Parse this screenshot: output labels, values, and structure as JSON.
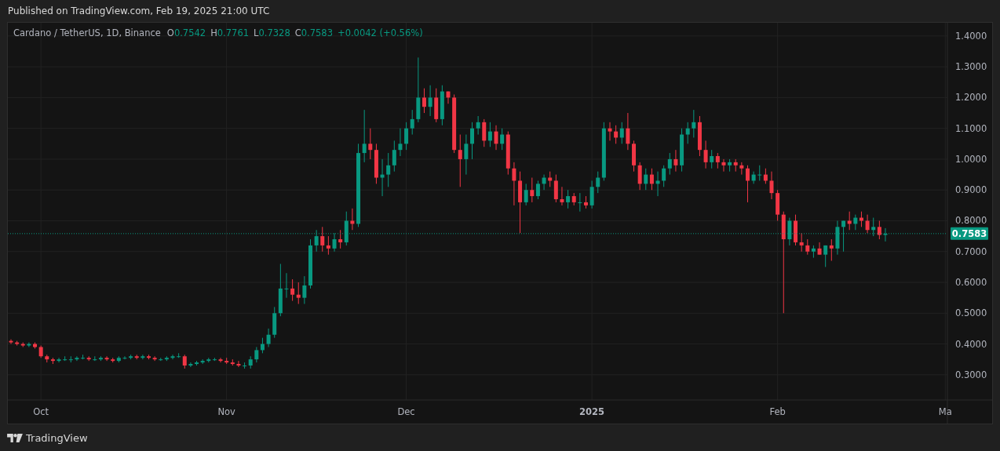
{
  "header": {
    "published": "Published on TradingView.com, Feb 19, 2025 21:00 UTC"
  },
  "legend": {
    "symbol": "Cardano / TetherUS, 1D, Binance",
    "values": [
      {
        "label": "O",
        "value": "0.7542"
      },
      {
        "label": "H",
        "value": "0.7761"
      },
      {
        "label": "L",
        "value": "0.7328"
      },
      {
        "label": "C",
        "value": "0.7583"
      }
    ],
    "change": "+0.0042 (+0.56%)"
  },
  "chart_data": {
    "type": "candlestick",
    "grid": true,
    "ylim": [
      0.218,
      1.443
    ],
    "yticks": [
      {
        "value": 1.4,
        "label": "1.4000"
      },
      {
        "value": 1.3,
        "label": "1.3000"
      },
      {
        "value": 1.2,
        "label": "1.2000"
      },
      {
        "value": 1.1,
        "label": "1.1000"
      },
      {
        "value": 1.0,
        "label": "1.0000"
      },
      {
        "value": 0.9,
        "label": "0.9000"
      },
      {
        "value": 0.8,
        "label": "0.8000"
      },
      {
        "value": 0.7,
        "label": "0.7000"
      },
      {
        "value": 0.6,
        "label": "0.6000"
      },
      {
        "value": 0.5,
        "label": "0.5000"
      },
      {
        "value": 0.4,
        "label": "0.4000"
      },
      {
        "value": 0.3,
        "label": "0.3000"
      }
    ],
    "categories": [
      null,
      null,
      null,
      null,
      null,
      "Oct",
      null,
      null,
      null,
      null,
      null,
      null,
      null,
      null,
      null,
      null,
      null,
      null,
      null,
      null,
      null,
      null,
      null,
      null,
      null,
      null,
      null,
      null,
      null,
      null,
      null,
      null,
      null,
      null,
      null,
      null,
      "Nov",
      null,
      null,
      null,
      null,
      null,
      null,
      null,
      null,
      null,
      null,
      null,
      null,
      null,
      null,
      null,
      null,
      null,
      null,
      null,
      null,
      null,
      null,
      null,
      null,
      null,
      null,
      null,
      null,
      null,
      "Dec",
      null,
      null,
      null,
      null,
      null,
      null,
      null,
      null,
      null,
      null,
      null,
      null,
      null,
      null,
      null,
      null,
      null,
      null,
      null,
      null,
      null,
      null,
      null,
      null,
      null,
      null,
      null,
      null,
      null,
      null,
      "2025",
      null,
      null,
      null,
      null,
      null,
      null,
      null,
      null,
      null,
      null,
      null,
      null,
      null,
      null,
      null,
      null,
      null,
      null,
      null,
      null,
      null,
      null,
      null,
      null,
      null,
      null,
      null,
      null,
      null,
      null,
      "Feb",
      null,
      null,
      null,
      null,
      null,
      null,
      null,
      null,
      null,
      null,
      null,
      null,
      null,
      null,
      null,
      null,
      null,
      null,
      null,
      null,
      null,
      null,
      null,
      null,
      null,
      null,
      null,
      "Ma"
    ],
    "ref_lines": [
      {
        "axis": "y",
        "value": 0.7583,
        "label": "0.7583",
        "color": "#089981"
      }
    ],
    "ohlc": [
      [
        0.41,
        0.415,
        0.4,
        0.405
      ],
      [
        0.405,
        0.41,
        0.395,
        0.4
      ],
      [
        0.4,
        0.405,
        0.39,
        0.395
      ],
      [
        0.395,
        0.405,
        0.39,
        0.4
      ],
      [
        0.4,
        0.405,
        0.385,
        0.39
      ],
      [
        0.39,
        0.395,
        0.355,
        0.36
      ],
      [
        0.36,
        0.365,
        0.34,
        0.35
      ],
      [
        0.35,
        0.355,
        0.335,
        0.345
      ],
      [
        0.345,
        0.355,
        0.34,
        0.35
      ],
      [
        0.35,
        0.36,
        0.345,
        0.35
      ],
      [
        0.35,
        0.36,
        0.34,
        0.35
      ],
      [
        0.35,
        0.36,
        0.345,
        0.355
      ],
      [
        0.355,
        0.365,
        0.35,
        0.355
      ],
      [
        0.355,
        0.36,
        0.345,
        0.35
      ],
      [
        0.35,
        0.36,
        0.345,
        0.35
      ],
      [
        0.35,
        0.36,
        0.345,
        0.355
      ],
      [
        0.355,
        0.36,
        0.345,
        0.35
      ],
      [
        0.35,
        0.355,
        0.34,
        0.345
      ],
      [
        0.345,
        0.36,
        0.34,
        0.355
      ],
      [
        0.355,
        0.36,
        0.35,
        0.355
      ],
      [
        0.355,
        0.365,
        0.35,
        0.36
      ],
      [
        0.36,
        0.365,
        0.35,
        0.355
      ],
      [
        0.355,
        0.365,
        0.35,
        0.36
      ],
      [
        0.36,
        0.365,
        0.35,
        0.355
      ],
      [
        0.355,
        0.36,
        0.345,
        0.35
      ],
      [
        0.35,
        0.355,
        0.345,
        0.35
      ],
      [
        0.35,
        0.36,
        0.345,
        0.355
      ],
      [
        0.355,
        0.365,
        0.35,
        0.36
      ],
      [
        0.36,
        0.37,
        0.355,
        0.36
      ],
      [
        0.36,
        0.365,
        0.32,
        0.33
      ],
      [
        0.33,
        0.34,
        0.325,
        0.335
      ],
      [
        0.335,
        0.345,
        0.33,
        0.34
      ],
      [
        0.34,
        0.35,
        0.335,
        0.345
      ],
      [
        0.345,
        0.355,
        0.34,
        0.35
      ],
      [
        0.35,
        0.355,
        0.345,
        0.35
      ],
      [
        0.35,
        0.355,
        0.34,
        0.345
      ],
      [
        0.345,
        0.355,
        0.335,
        0.34
      ],
      [
        0.34,
        0.35,
        0.33,
        0.335
      ],
      [
        0.335,
        0.345,
        0.325,
        0.33
      ],
      [
        0.33,
        0.34,
        0.32,
        0.33
      ],
      [
        0.33,
        0.36,
        0.32,
        0.35
      ],
      [
        0.35,
        0.39,
        0.34,
        0.38
      ],
      [
        0.38,
        0.42,
        0.37,
        0.4
      ],
      [
        0.4,
        0.45,
        0.39,
        0.43
      ],
      [
        0.43,
        0.52,
        0.42,
        0.5
      ],
      [
        0.5,
        0.66,
        0.49,
        0.58
      ],
      [
        0.58,
        0.63,
        0.55,
        0.58
      ],
      [
        0.58,
        0.61,
        0.54,
        0.56
      ],
      [
        0.56,
        0.6,
        0.53,
        0.55
      ],
      [
        0.55,
        0.62,
        0.53,
        0.59
      ],
      [
        0.59,
        0.74,
        0.58,
        0.72
      ],
      [
        0.72,
        0.77,
        0.7,
        0.75
      ],
      [
        0.75,
        0.78,
        0.7,
        0.72
      ],
      [
        0.72,
        0.75,
        0.69,
        0.71
      ],
      [
        0.71,
        0.76,
        0.7,
        0.74
      ],
      [
        0.74,
        0.77,
        0.71,
        0.73
      ],
      [
        0.73,
        0.83,
        0.72,
        0.8
      ],
      [
        0.8,
        0.84,
        0.77,
        0.79
      ],
      [
        0.79,
        1.05,
        0.78,
        1.02
      ],
      [
        1.02,
        1.16,
        0.99,
        1.05
      ],
      [
        1.05,
        1.1,
        1.0,
        1.03
      ],
      [
        1.03,
        1.05,
        0.92,
        0.94
      ],
      [
        0.94,
        1.0,
        0.88,
        0.95
      ],
      [
        0.95,
        1.02,
        0.91,
        0.98
      ],
      [
        0.98,
        1.06,
        0.96,
        1.03
      ],
      [
        1.03,
        1.1,
        1.01,
        1.05
      ],
      [
        1.05,
        1.12,
        1.03,
        1.1
      ],
      [
        1.1,
        1.16,
        1.08,
        1.13
      ],
      [
        1.13,
        1.33,
        1.12,
        1.2
      ],
      [
        1.2,
        1.23,
        1.15,
        1.17
      ],
      [
        1.17,
        1.24,
        1.14,
        1.2
      ],
      [
        1.2,
        1.23,
        1.12,
        1.13
      ],
      [
        1.13,
        1.24,
        1.11,
        1.22
      ],
      [
        1.22,
        1.22,
        1.18,
        1.2
      ],
      [
        1.2,
        1.21,
        1.02,
        1.03
      ],
      [
        1.03,
        1.08,
        0.91,
        1.0
      ],
      [
        1.0,
        1.08,
        0.95,
        1.05
      ],
      [
        1.05,
        1.12,
        1.0,
        1.1
      ],
      [
        1.1,
        1.14,
        1.08,
        1.12
      ],
      [
        1.12,
        1.13,
        1.04,
        1.06
      ],
      [
        1.06,
        1.12,
        1.04,
        1.09
      ],
      [
        1.09,
        1.11,
        1.03,
        1.05
      ],
      [
        1.05,
        1.1,
        1.03,
        1.08
      ],
      [
        1.08,
        1.09,
        0.95,
        0.97
      ],
      [
        0.97,
        0.99,
        0.85,
        0.93
      ],
      [
        0.93,
        0.96,
        0.76,
        0.86
      ],
      [
        0.86,
        0.92,
        0.85,
        0.9
      ],
      [
        0.9,
        0.94,
        0.86,
        0.88
      ],
      [
        0.88,
        0.93,
        0.87,
        0.92
      ],
      [
        0.92,
        0.95,
        0.9,
        0.94
      ],
      [
        0.94,
        0.96,
        0.91,
        0.93
      ],
      [
        0.93,
        0.95,
        0.86,
        0.87
      ],
      [
        0.87,
        0.91,
        0.85,
        0.86
      ],
      [
        0.86,
        0.9,
        0.84,
        0.88
      ],
      [
        0.88,
        0.89,
        0.85,
        0.86
      ],
      [
        0.86,
        0.89,
        0.83,
        0.86
      ],
      [
        0.86,
        0.88,
        0.84,
        0.85
      ],
      [
        0.85,
        0.93,
        0.84,
        0.91
      ],
      [
        0.91,
        0.96,
        0.89,
        0.94
      ],
      [
        0.94,
        1.12,
        0.93,
        1.1
      ],
      [
        1.1,
        1.12,
        1.06,
        1.09
      ],
      [
        1.09,
        1.11,
        1.05,
        1.07
      ],
      [
        1.07,
        1.12,
        1.05,
        1.1
      ],
      [
        1.1,
        1.15,
        1.03,
        1.05
      ],
      [
        1.05,
        1.06,
        0.96,
        0.98
      ],
      [
        0.98,
        0.99,
        0.9,
        0.92
      ],
      [
        0.92,
        0.97,
        0.9,
        0.95
      ],
      [
        0.95,
        0.97,
        0.9,
        0.92
      ],
      [
        0.92,
        0.96,
        0.88,
        0.93
      ],
      [
        0.93,
        0.98,
        0.91,
        0.97
      ],
      [
        0.97,
        1.02,
        0.95,
        1.0
      ],
      [
        1.0,
        1.03,
        0.96,
        0.98
      ],
      [
        0.98,
        1.1,
        0.96,
        1.08
      ],
      [
        1.08,
        1.12,
        1.05,
        1.1
      ],
      [
        1.1,
        1.16,
        1.07,
        1.12
      ],
      [
        1.12,
        1.14,
        1.01,
        1.03
      ],
      [
        1.03,
        1.06,
        0.97,
        0.99
      ],
      [
        0.99,
        1.03,
        0.97,
        1.01
      ],
      [
        1.01,
        1.02,
        0.97,
        0.99
      ],
      [
        0.99,
        1.0,
        0.96,
        0.98
      ],
      [
        0.98,
        1.0,
        0.96,
        0.99
      ],
      [
        0.99,
        1.0,
        0.96,
        0.98
      ],
      [
        0.98,
        0.99,
        0.95,
        0.97
      ],
      [
        0.97,
        0.98,
        0.86,
        0.93
      ],
      [
        0.93,
        0.96,
        0.92,
        0.95
      ],
      [
        0.95,
        0.98,
        0.93,
        0.95
      ],
      [
        0.95,
        0.97,
        0.92,
        0.93
      ],
      [
        0.93,
        0.96,
        0.87,
        0.89
      ],
      [
        0.89,
        0.9,
        0.8,
        0.82
      ],
      [
        0.82,
        0.83,
        0.5,
        0.74
      ],
      [
        0.74,
        0.81,
        0.72,
        0.8
      ],
      [
        0.8,
        0.82,
        0.72,
        0.73
      ],
      [
        0.73,
        0.76,
        0.7,
        0.72
      ],
      [
        0.72,
        0.74,
        0.69,
        0.7
      ],
      [
        0.7,
        0.72,
        0.68,
        0.71
      ],
      [
        0.71,
        0.73,
        0.69,
        0.69
      ],
      [
        0.69,
        0.72,
        0.65,
        0.72
      ],
      [
        0.72,
        0.74,
        0.67,
        0.71
      ],
      [
        0.71,
        0.8,
        0.69,
        0.78
      ],
      [
        0.78,
        0.8,
        0.7,
        0.8
      ],
      [
        0.8,
        0.83,
        0.77,
        0.79
      ],
      [
        0.79,
        0.82,
        0.77,
        0.81
      ],
      [
        0.81,
        0.83,
        0.78,
        0.8
      ],
      [
        0.8,
        0.82,
        0.76,
        0.77
      ],
      [
        0.77,
        0.81,
        0.75,
        0.78
      ],
      [
        0.78,
        0.8,
        0.74,
        0.754
      ],
      [
        0.754,
        0.776,
        0.733,
        0.758
      ],
      null,
      null,
      null,
      null,
      null,
      null,
      null,
      null,
      null,
      null
    ]
  },
  "footer": {
    "brand": "TradingView"
  }
}
